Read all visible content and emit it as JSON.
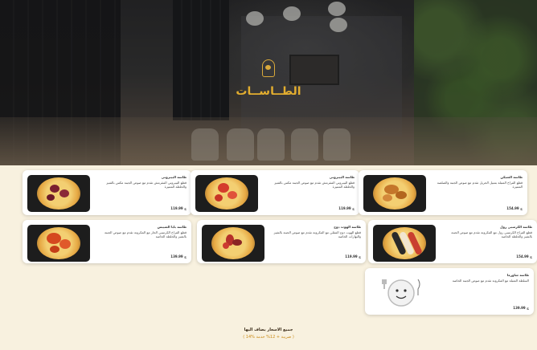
{
  "restaurant": {
    "name": "الطــاســات",
    "logo_icon": "bowl-logo-icon",
    "accent_color": "#e2ad2f"
  },
  "items": [
    {
      "title": "طاسة الشيكن",
      "description": "قطع الفراخ المتبلة بتتبيل الجريل تقدم مع صوص الجبنة والصلصة المميزة",
      "price": "154.99 ج"
    },
    {
      "title": "طاسة البيبروني",
      "description": "قطع البيبروني المقرمش تقدم مع صوص الجبنة مكس بالشيز والخلطة المميزة",
      "price": "119.99 ج"
    },
    {
      "title": "طاسة الهوت دوج",
      "description": "قطع الهوت دوج المقلي مع المكرونة تقدم مع صوص الجبنة بالشيز والبهارات الخاصة",
      "price": "119.99 ج"
    },
    {
      "title": "طاسة الكرسبي رول",
      "description": "قطع الفراخ الكرسبي رول مع المكرونة تقدم مع صوص الجبنة بالشيز والخلطة الخاصة",
      "price": "154.99 ج"
    },
    {
      "title": "طاسة سوسيس",
      "description": "قطع السوسيس المحمر مع المكرونة تقدم مع صوص الجبنة بالشيز والخلطة الخاصة",
      "price": "119.99 ج"
    },
    {
      "title": "طاسة بابا الشيبس",
      "description": "قطع الفراخ الكرسبي الحار مع المكرونة تقدم مع صوص الجبنة بالشيز والخلطة الخاصة",
      "price": "139.99 ج"
    },
    {
      "title": "طاسة شاورما",
      "description": "السلطة المتبلة مع المكرونة تقدم مع صوص الجبنة الخاصة",
      "price": "139.99 ج"
    }
  ],
  "footer": {
    "line1": "جميع الاسعار يضاف اليها",
    "line2": "( 14% ضريبة + 12% خدمة )"
  }
}
